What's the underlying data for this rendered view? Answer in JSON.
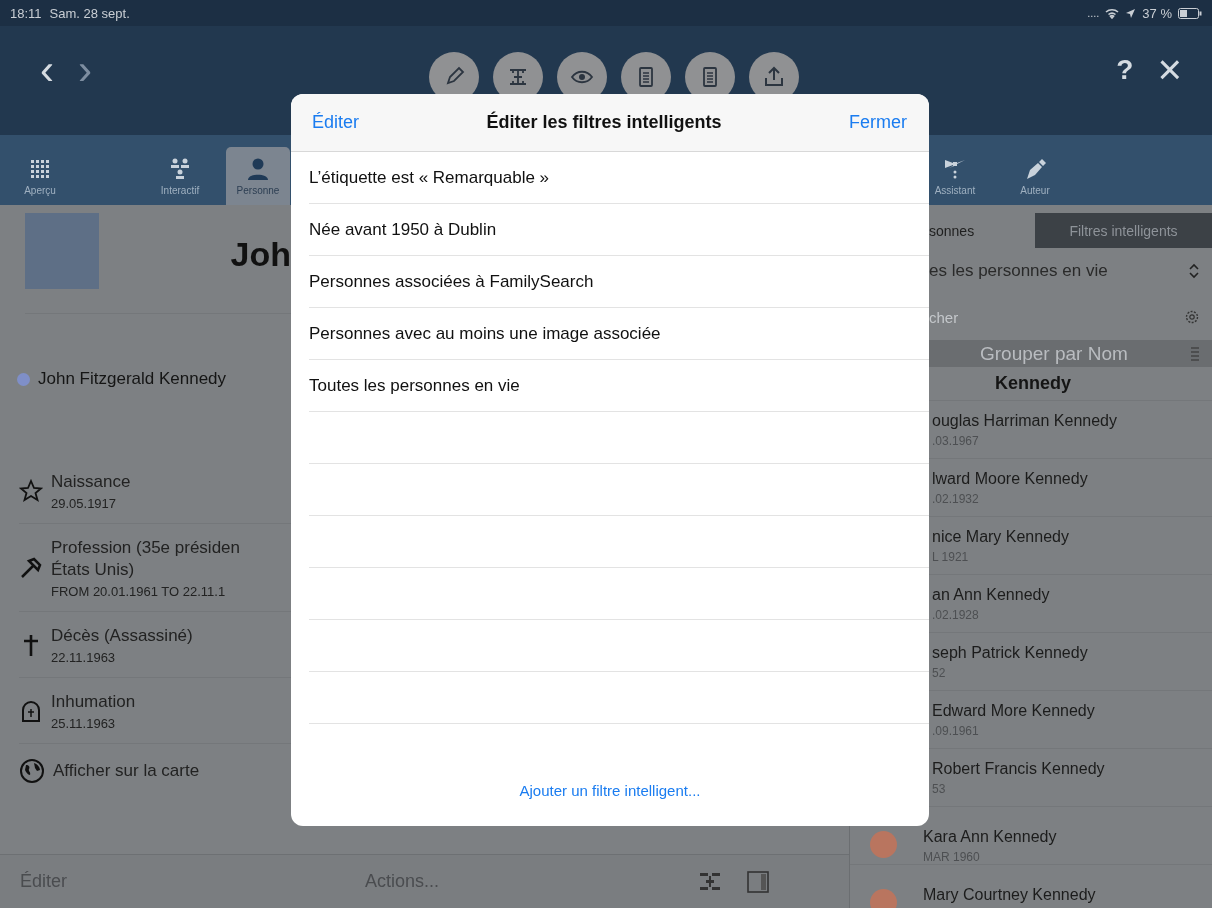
{
  "status_bar": {
    "time": "18:11",
    "date": "Sam. 28 sept.",
    "signal_dots": "....",
    "battery": "37 %"
  },
  "nav": {
    "back": "‹",
    "forward": "›",
    "help": "?",
    "close": "×",
    "tools": [
      {
        "kind": "pencil"
      },
      {
        "kind": "tree"
      },
      {
        "kind": "eye"
      },
      {
        "kind": "document"
      },
      {
        "kind": "document"
      },
      {
        "kind": "upload"
      }
    ]
  },
  "tabbar": {
    "items": [
      {
        "label": "Aperçu",
        "kind": "grid",
        "selected": false
      },
      {
        "label": "Interactif",
        "kind": "people",
        "selected": false
      },
      {
        "label": "Personne",
        "kind": "person",
        "selected": true
      },
      {
        "label": "Assistant",
        "kind": "wizard",
        "selected": false
      },
      {
        "label": "Auteur",
        "kind": "pen",
        "selected": false
      }
    ]
  },
  "person": {
    "name_heading": "Joh",
    "full_name": "John Fitzgerald Kennedy",
    "color": "#7f8fc8",
    "events": [
      {
        "kind": "birth",
        "title_lines": [
          "Naissance"
        ],
        "date": "29.05.1917"
      },
      {
        "kind": "occupation",
        "title_lines": [
          "Profession (35e présiden",
          "États Unis)"
        ],
        "date": "FROM 20.01.1961 TO 22.11.1"
      },
      {
        "kind": "death",
        "title_lines": [
          "Décès (Assassiné)"
        ],
        "date": "22.11.1963"
      },
      {
        "kind": "burial",
        "title_lines": [
          "Inhumation"
        ],
        "date": "25.11.1963"
      }
    ],
    "map_link": "Afficher sur la carte"
  },
  "bottom_bar": {
    "edit": "Éditer",
    "actions": "Actions..."
  },
  "people_panel": {
    "segments": [
      {
        "label": "sonnes",
        "selected": false
      },
      {
        "label": "Filtres intelligents",
        "selected": true
      }
    ],
    "filter": "es les personnes en vie",
    "search": {
      "placeholder": "cher"
    },
    "group_by": "Grouper par Nom",
    "section": "Kennedy",
    "rows": [
      {
        "name": "ouglas Harriman Kennedy",
        "date": ".03.1967"
      },
      {
        "name": "lward Moore Kennedy",
        "date": ".02.1932"
      },
      {
        "name": "nice Mary Kennedy",
        "date": "L 1921"
      },
      {
        "name": "an Ann Kennedy",
        "date": ".02.1928"
      },
      {
        "name": "seph Patrick Kennedy",
        "date": "52"
      },
      {
        "name": "Edward More Kennedy",
        "date": ".09.1961"
      },
      {
        "name": "Robert Francis Kennedy",
        "date": "53"
      },
      {
        "name": "Kara Ann Kennedy",
        "date": "MAR 1960",
        "color": "#b9755f"
      },
      {
        "name": "Mary Courtney Kennedy",
        "color": "#b9755f"
      }
    ]
  },
  "modal": {
    "edit": "Éditer",
    "title": "Éditer les filtres intelligents",
    "close": "Fermer",
    "filters": [
      "L’étiquette est « Remarquable »",
      "Née avant 1950 à Dublin",
      "Personnes associées à FamilySearch",
      "Personnes avec au moins une image associée",
      "Toutes les personnes en vie"
    ],
    "add": "Ajouter un filtre intelligent..."
  }
}
